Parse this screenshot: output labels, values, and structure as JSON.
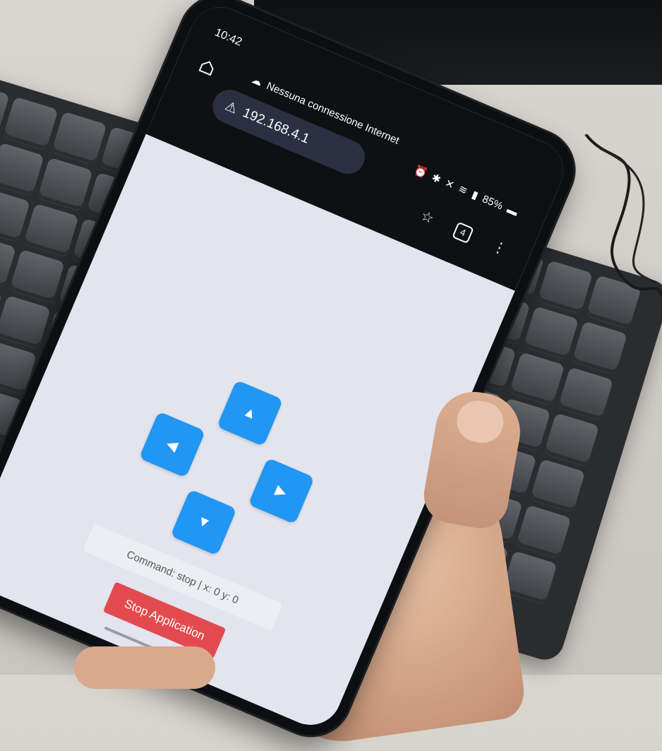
{
  "statusbar": {
    "time": "10:42",
    "connection_notice": "Nessuna connessione Internet",
    "battery": "85%"
  },
  "browser": {
    "url": "192.168.4.1",
    "tab_count": "4"
  },
  "controller": {
    "up_label": "▲",
    "left_label": "◀",
    "right_label": "▶",
    "down_label": "▼",
    "command_readout": "Command: stop | x: 0 y: 0",
    "stop_button": "Stop Application"
  },
  "colors": {
    "arrow_button": "#2196f3",
    "stop_button": "#e34a4f",
    "page_background": "#e3e4ee"
  },
  "icons": [
    "home-icon",
    "cloud-off-icon",
    "warning-icon",
    "star-icon",
    "tabs-icon",
    "more-vert-icon",
    "wifi-icon",
    "bluetooth-icon",
    "alarm-icon",
    "mute-icon",
    "signal-icon",
    "battery-icon"
  ]
}
